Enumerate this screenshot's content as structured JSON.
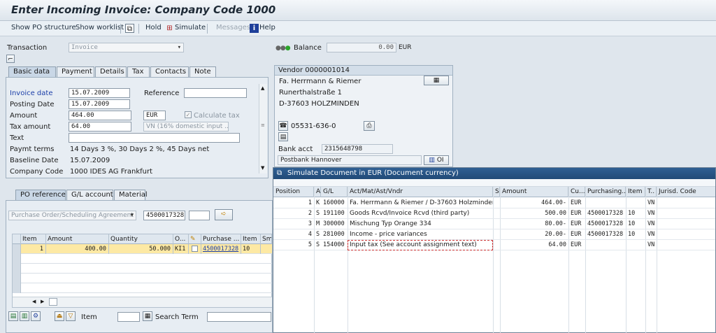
{
  "window": {
    "title": "Enter Incoming Invoice: Company Code 1000"
  },
  "toolbar": {
    "show_po_structure": "Show PO structure",
    "show_worklist": "Show worklist",
    "hold": "Hold",
    "simulate": "Simulate",
    "messages": "Messages",
    "help": "Help"
  },
  "header": {
    "transaction_label": "Transaction",
    "transaction_value": "Invoice",
    "balance_label": "Balance",
    "balance_value": "0.00",
    "balance_currency": "EUR"
  },
  "tabs": [
    "Basic data",
    "Payment",
    "Details",
    "Tax",
    "Contacts",
    "Note"
  ],
  "basic": {
    "invoice_date_label": "Invoice date",
    "invoice_date": "15.07.2009",
    "reference_label": "Reference",
    "posting_date_label": "Posting Date",
    "posting_date": "15.07.2009",
    "amount_label": "Amount",
    "amount": "464.00",
    "amount_currency": "EUR",
    "calc_tax_label": "Calculate tax",
    "tax_amount_label": "Tax amount",
    "tax_amount": "64.00",
    "tax_code": "VN (16% domestic input ...",
    "text_label": "Text",
    "paymt_terms_label": "Paymt terms",
    "paymt_terms": "14 Days 3 %, 30 Days 2 %, 45 Days net",
    "baseline_date_label": "Baseline Date",
    "baseline_date": "15.07.2009",
    "company_code_label": "Company Code",
    "company_code": "1000 IDES AG Frankfurt"
  },
  "vendor": {
    "title": "Vendor 0000001014",
    "name": "Fa. Herrmann & Riemer",
    "street": "Runerthalstraße 1",
    "city": "D-37603 HOLZMINDEN",
    "phone": "05531-636-0",
    "bank_acct_label": "Bank acct",
    "bank_acct": "2315648798",
    "bank_name": "Postbank Hannover",
    "oi_label": "OI"
  },
  "ref_tabs": [
    "PO reference",
    "G/L account",
    "Material"
  ],
  "po_ref": {
    "selector": "Purchase Order/Scheduling Agreement",
    "po_number": "4500017328",
    "columns": [
      "Item",
      "Amount",
      "Quantity",
      "O...",
      "",
      "Purchase ...",
      "Item",
      "Sm"
    ],
    "rows": [
      {
        "item": "1",
        "amount": "400.00",
        "quantity": "50.000",
        "unit": "KI1",
        "po": "4500017328",
        "po_item": "10"
      }
    ],
    "item_label": "Item",
    "search_term_label": "Search Term"
  },
  "simulate": {
    "title": "Simulate Document in EUR (Document currency)",
    "columns": [
      "Position",
      "A",
      "G/L",
      "Act/Mat/Ast/Vndr",
      "S",
      "Amount",
      "Cu...",
      "Purchasing...",
      "Item",
      "T..",
      "Jurisd. Code"
    ],
    "rows": [
      {
        "pos": "1",
        "a": "K",
        "gl": "160000",
        "text": "Fa. Herrmann & Riemer / D-37603 Holzminden",
        "amount": "464.00-",
        "cur": "EUR",
        "po": "",
        "item": "",
        "tax": "VN"
      },
      {
        "pos": "2",
        "a": "S",
        "gl": "191100",
        "text": "Goods Rcvd/Invoice Rcvd (third party)",
        "amount": "500.00",
        "cur": "EUR",
        "po": "4500017328",
        "item": "10",
        "tax": "VN"
      },
      {
        "pos": "3",
        "a": "M",
        "gl": "300000",
        "text": "Mischung Typ Orange 334",
        "amount": "80.00-",
        "cur": "EUR",
        "po": "4500017328",
        "item": "10",
        "tax": "VN"
      },
      {
        "pos": "4",
        "a": "S",
        "gl": "281000",
        "text": "Income - price variances",
        "amount": "20.00-",
        "cur": "EUR",
        "po": "4500017328",
        "item": "10",
        "tax": "VN"
      },
      {
        "pos": "5",
        "a": "S",
        "gl": "154000",
        "text": "Input tax (See account assignment text)",
        "amount": "64.00",
        "cur": "EUR",
        "po": "",
        "item": "",
        "tax": "VN"
      }
    ]
  },
  "colors": {
    "accent": "#214a77",
    "selected_row": "#fde9a4",
    "panel": "#e7edf3"
  }
}
